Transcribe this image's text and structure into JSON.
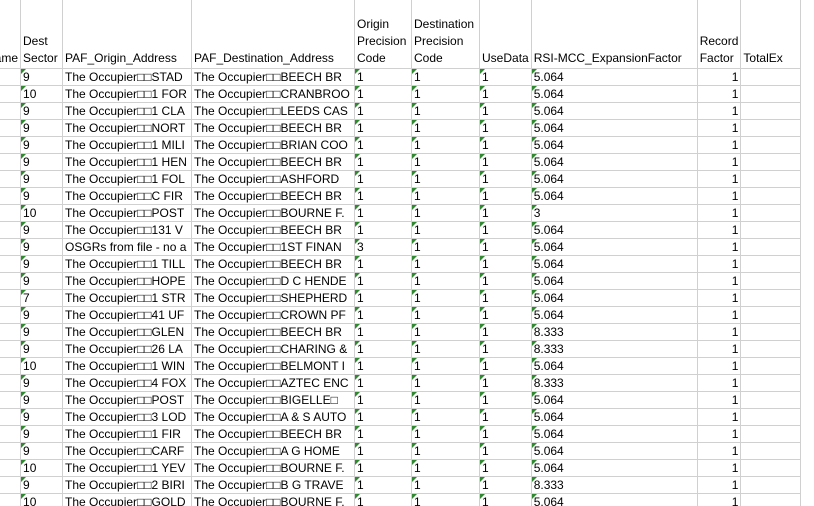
{
  "headers": [
    "Name",
    "Dest Sector",
    "PAF_Origin_Address",
    "PAF_Destination_Address",
    "Origin Precision Code",
    "Destination Precision Code",
    "UseData",
    "RSI-MCC_ExpansionFactor",
    "Record Factor",
    "TotalEx"
  ],
  "rows": [
    [
      "9",
      "The Occupier□□STAD",
      "The Occupier□□BEECH BR",
      "1",
      "1",
      "1",
      "5.064",
      "1"
    ],
    [
      "10",
      "The Occupier□□1 FOR",
      "The Occupier□□CRANBROO",
      "1",
      "1",
      "1",
      "5.064",
      "1"
    ],
    [
      "9",
      "The Occupier□□1 CLA",
      "The Occupier□□LEEDS CAS",
      "1",
      "1",
      "1",
      "5.064",
      "1"
    ],
    [
      "9",
      "The Occupier□□NORT",
      "The Occupier□□BEECH BR",
      "1",
      "1",
      "1",
      "5.064",
      "1"
    ],
    [
      "9",
      "The Occupier□□1 MILI",
      "The Occupier□□BRIAN COO",
      "1",
      "1",
      "1",
      "5.064",
      "1"
    ],
    [
      "9",
      "The Occupier□□1 HEN",
      "The Occupier□□BEECH BR",
      "1",
      "1",
      "1",
      "5.064",
      "1"
    ],
    [
      "9",
      "The Occupier□□1 FOL",
      "The Occupier□□ASHFORD",
      "1",
      "1",
      "1",
      "5.064",
      "1"
    ],
    [
      "9",
      "The Occupier□□C FIR",
      "The Occupier□□BEECH BR",
      "1",
      "1",
      "1",
      "5.064",
      "1"
    ],
    [
      "10",
      "The Occupier□□POST",
      "The Occupier□□BOURNE F.",
      "1",
      "1",
      "1",
      "3",
      "1"
    ],
    [
      "9",
      "The Occupier□□131 V",
      "The Occupier□□BEECH BR",
      "1",
      "1",
      "1",
      "5.064",
      "1"
    ],
    [
      "9",
      "OSGRs from file - no a",
      "The Occupier□□1ST FINAN",
      "3",
      "1",
      "1",
      "5.064",
      "1"
    ],
    [
      "9",
      "The Occupier□□1 TILL",
      "The Occupier□□BEECH BR",
      "1",
      "1",
      "1",
      "5.064",
      "1"
    ],
    [
      "9",
      "The Occupier□□HOPE",
      "The Occupier□□D C HENDE",
      "1",
      "1",
      "1",
      "5.064",
      "1"
    ],
    [
      "7",
      "The Occupier□□1 STR",
      "The Occupier□□SHEPHERD",
      "1",
      "1",
      "1",
      "5.064",
      "1"
    ],
    [
      "9",
      "The Occupier□□41 UF",
      "The Occupier□□CROWN PF",
      "1",
      "1",
      "1",
      "5.064",
      "1"
    ],
    [
      "9",
      "The Occupier□□GLEN",
      "The Occupier□□BEECH BR",
      "1",
      "1",
      "1",
      "8.333",
      "1"
    ],
    [
      "9",
      "The Occupier□□26 LA",
      "The Occupier□□CHARING &",
      "1",
      "1",
      "1",
      "8.333",
      "1"
    ],
    [
      "10",
      "The Occupier□□1 WIN",
      "The Occupier□□BELMONT I",
      "1",
      "1",
      "1",
      "5.064",
      "1"
    ],
    [
      "9",
      "The Occupier□□4 FOX",
      "The Occupier□□AZTEC ENC",
      "1",
      "1",
      "1",
      "8.333",
      "1"
    ],
    [
      "9",
      "The Occupier□□POST",
      "The Occupier□□BIGELLE□",
      "1",
      "1",
      "1",
      "5.064",
      "1"
    ],
    [
      "9",
      "The Occupier□□3 LOD",
      "The Occupier□□A & S AUTO",
      "1",
      "1",
      "1",
      "5.064",
      "1"
    ],
    [
      "9",
      "The Occupier□□1 FIR",
      "The Occupier□□BEECH BR",
      "1",
      "1",
      "1",
      "5.064",
      "1"
    ],
    [
      "9",
      "The Occupier□□CARF",
      "The Occupier□□A G HOME",
      "1",
      "1",
      "1",
      "5.064",
      "1"
    ],
    [
      "10",
      "The Occupier□□1 YEV",
      "The Occupier□□BOURNE F.",
      "1",
      "1",
      "1",
      "5.064",
      "1"
    ],
    [
      "9",
      "The Occupier□□2 BIRI",
      "The Occupier□□B G TRAVE",
      "1",
      "1",
      "1",
      "8.333",
      "1"
    ],
    [
      "10",
      "The Occupier□□GOLD",
      "The Occupier□□BOURNE F.",
      "1",
      "1",
      "1",
      "5.064",
      "1"
    ]
  ],
  "colors": {
    "grid": "#d0d0d0",
    "error_flag": "#2f8a2f"
  }
}
